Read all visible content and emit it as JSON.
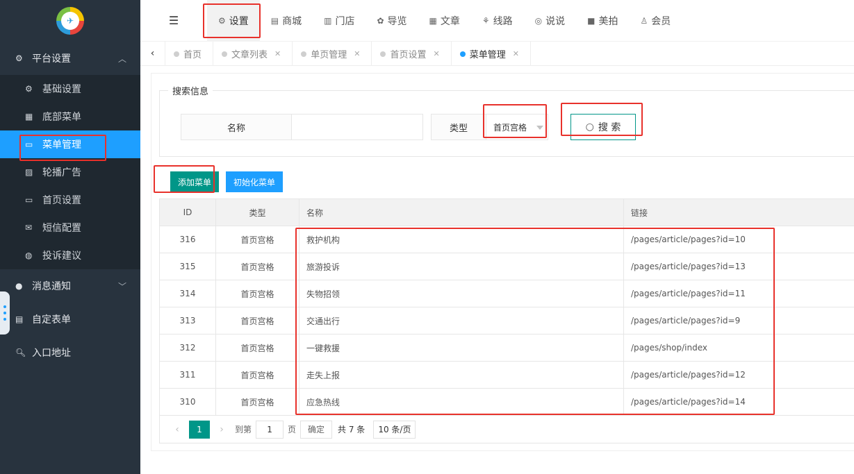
{
  "logo": {
    "text": "✈"
  },
  "sidebar": {
    "group_platform": {
      "label": "平台设置",
      "icon": "gear-icon"
    },
    "sub_items": [
      {
        "label": "基础设置",
        "icon": "gear-icon",
        "glyph": "⚙"
      },
      {
        "label": "底部菜单",
        "icon": "grid-icon",
        "glyph": "▦"
      },
      {
        "label": "菜单管理",
        "icon": "monitor-icon",
        "glyph": "▭",
        "active": true
      },
      {
        "label": "轮播广告",
        "icon": "image-icon",
        "glyph": "▨"
      },
      {
        "label": "首页设置",
        "icon": "monitor-icon",
        "glyph": "▭"
      },
      {
        "label": "短信配置",
        "icon": "mail-icon",
        "glyph": "✉"
      },
      {
        "label": "投诉建议",
        "icon": "chat-icon",
        "glyph": "◍"
      }
    ],
    "group_notify": {
      "label": "消息通知",
      "icon": "chat-icon"
    },
    "group_form": {
      "label": "自定表单",
      "icon": "form-icon"
    },
    "group_entry": {
      "label": "入口地址",
      "icon": "search-icon"
    }
  },
  "topnav": {
    "tabs": [
      {
        "label": "设置",
        "glyph": "⚙",
        "icon": "gears-icon",
        "active": true
      },
      {
        "label": "商城",
        "glyph": "▤",
        "icon": "shop-icon"
      },
      {
        "label": "门店",
        "glyph": "▥",
        "icon": "bank-icon"
      },
      {
        "label": "导览",
        "glyph": "✿",
        "icon": "guide-icon"
      },
      {
        "label": "文章",
        "glyph": "▦",
        "icon": "article-icon"
      },
      {
        "label": "线路",
        "glyph": "⚘",
        "icon": "route-icon"
      },
      {
        "label": "说说",
        "glyph": "◎",
        "icon": "wechat-icon"
      },
      {
        "label": "美拍",
        "glyph": "■",
        "icon": "camera-icon"
      },
      {
        "label": "会员",
        "glyph": "♙",
        "icon": "member-icon"
      }
    ]
  },
  "page_tabs": [
    {
      "label": "首页",
      "closable": false
    },
    {
      "label": "文章列表",
      "closable": true
    },
    {
      "label": "单页管理",
      "closable": true
    },
    {
      "label": "首页设置",
      "closable": true
    },
    {
      "label": "菜单管理",
      "closable": true,
      "active": true
    }
  ],
  "search": {
    "legend": "搜索信息",
    "name_label": "名称",
    "name_value": "",
    "type_label": "类型",
    "type_selected": "首页宫格",
    "search_button": "搜 索"
  },
  "actions": {
    "add_menu": "添加菜单",
    "init_menu": "初始化菜单"
  },
  "table": {
    "headers": {
      "id": "ID",
      "type": "类型",
      "name": "名称",
      "link": "链接"
    },
    "rows": [
      {
        "id": "316",
        "type": "首页宫格",
        "name": "救护机构",
        "link": "/pages/article/pages?id=10"
      },
      {
        "id": "315",
        "type": "首页宫格",
        "name": "旅游投诉",
        "link": "/pages/article/pages?id=13"
      },
      {
        "id": "314",
        "type": "首页宫格",
        "name": "失物招领",
        "link": "/pages/article/pages?id=11"
      },
      {
        "id": "313",
        "type": "首页宫格",
        "name": "交通出行",
        "link": "/pages/article/pages?id=9"
      },
      {
        "id": "312",
        "type": "首页宫格",
        "name": "一键救援",
        "link": "/pages/shop/index"
      },
      {
        "id": "311",
        "type": "首页宫格",
        "name": "走失上报",
        "link": "/pages/article/pages?id=12"
      },
      {
        "id": "310",
        "type": "首页宫格",
        "name": "应急热线",
        "link": "/pages/article/pages?id=14"
      }
    ]
  },
  "pager": {
    "current": "1",
    "goto_label": "到第",
    "goto_value": "1",
    "page_unit": "页",
    "confirm": "确定",
    "total": "共 7 条",
    "page_size": "10 条/页"
  },
  "colors": {
    "accent": "#1e9fff",
    "primary": "#009688",
    "highlight": "#e8312b",
    "sidebar": "#28333e"
  }
}
